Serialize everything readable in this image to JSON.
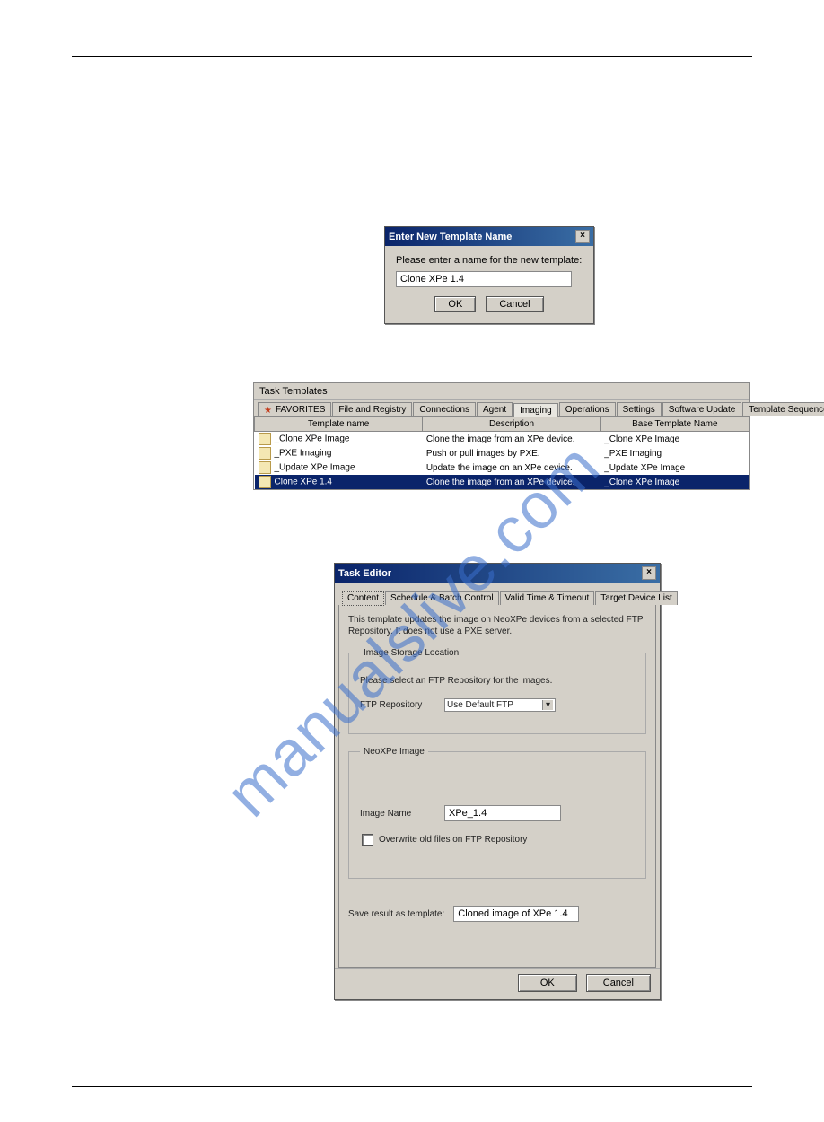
{
  "watermark": "manualslive.com",
  "dialog1": {
    "title": "Enter New Template Name",
    "prompt": "Please enter a name for the new template:",
    "value": "Clone XPe 1.4",
    "ok": "OK",
    "cancel": "Cancel"
  },
  "taskTemplates": {
    "title": "Task Templates",
    "tabs": [
      "FAVORITES",
      "File and Registry",
      "Connections",
      "Agent",
      "Imaging",
      "Operations",
      "Settings",
      "Software Update",
      "Template Sequence"
    ],
    "activeTab": "Imaging",
    "columns": [
      "Template name",
      "Description",
      "Base Template Name"
    ],
    "rows": [
      {
        "name": "_Clone XPe Image",
        "desc": "Clone the image from an XPe device.",
        "base": "_Clone XPe Image",
        "selected": false
      },
      {
        "name": "_PXE Imaging",
        "desc": "Push or pull images by PXE.",
        "base": "_PXE Imaging",
        "selected": false
      },
      {
        "name": "_Update XPe Image",
        "desc": "Update the image on an XPe device.",
        "base": "_Update XPe Image",
        "selected": false
      },
      {
        "name": "Clone XPe 1.4",
        "desc": "Clone the image from an XPe device.",
        "base": "_Clone XPe Image",
        "selected": true
      }
    ]
  },
  "taskEditor": {
    "title": "Task Editor",
    "tabs": [
      "Content",
      "Schedule & Batch Control",
      "Valid Time & Timeout",
      "Target Device List"
    ],
    "activeTab": "Content",
    "info": "This template updates the image on NeoXPe devices from a selected FTP Repository. It does not use a PXE server.",
    "group1": {
      "legend": "Image Storage Location",
      "hint": "Please select an FTP Repository for the images.",
      "ftpLabel": "FTP Repository",
      "ftpValue": "Use Default FTP"
    },
    "group2": {
      "legend": "NeoXPe Image",
      "imgLabel": "Image Name",
      "imgValue": "XPe_1.4",
      "overwrite": "Overwrite old files on FTP Repository"
    },
    "saveLabel": "Save result as template:",
    "saveValue": "Cloned image of XPe 1.4",
    "ok": "OK",
    "cancel": "Cancel"
  }
}
